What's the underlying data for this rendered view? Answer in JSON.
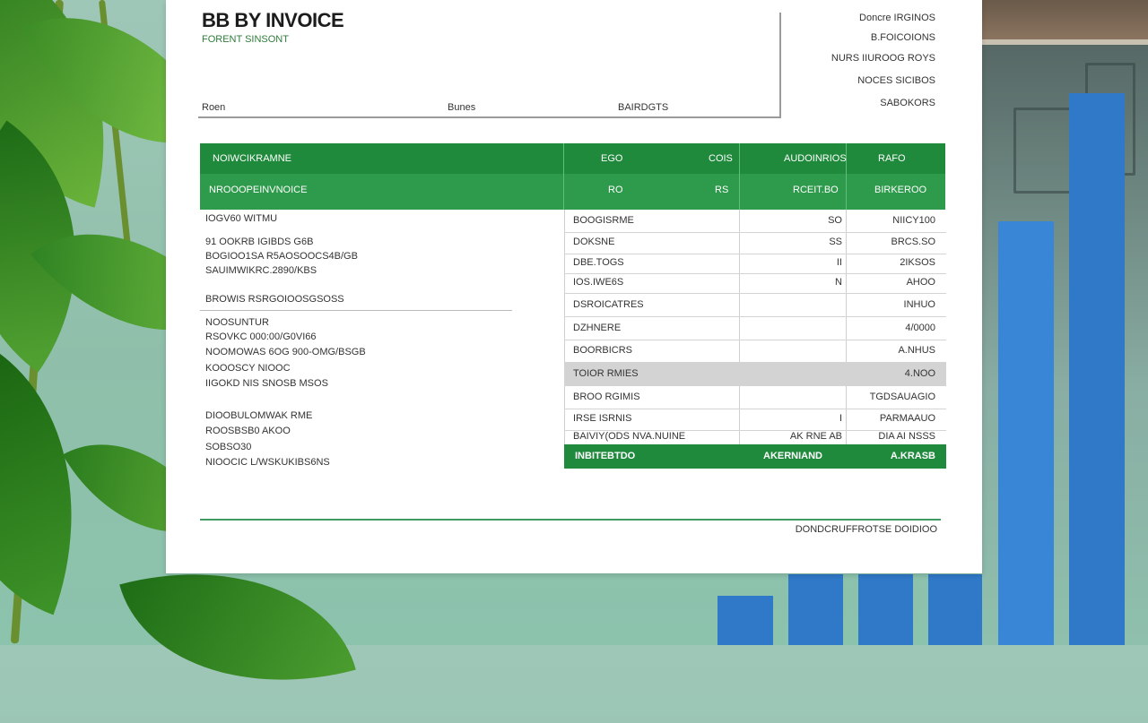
{
  "invoice": {
    "title": "BB BY INVOICE",
    "subtitle": "FORENT SINSONT",
    "header_labels": [
      "Roen",
      "Bunes",
      "BAIRDGTS"
    ],
    "meta": [
      "Doncre IRGINOS",
      "B.FOICOIONS",
      "NURS IIUROOG ROYS",
      "NOCES SICIBOS",
      "SABOKORS"
    ],
    "table_header_row1": [
      "NOIWCIKRAMNE",
      "EGO",
      "COIS",
      "AUDOINRIOS",
      "RAFO"
    ],
    "table_header_row2": [
      "NROOOPEINVNOICE",
      "RO",
      "RS",
      "RCEIT.BO",
      "BIRKEROO"
    ],
    "left_blocks": [
      [
        "IOGV60 WITMU"
      ],
      [
        "91 OOKRB IGIBDS G6B",
        "BOGIOO1SA R5AOSOOCS4B/GB",
        "SAUIMWIKRC.2890/KBS"
      ],
      [
        "BROWIS RSRGOIOOSGSOSS"
      ],
      [
        "NOOSUNTUR",
        "RSOVKC 000:00/G0VI66",
        "NOOMOWAS 6OG 900-OMG/BSGB"
      ],
      [
        "KOOOSCY NIOOC",
        "IIGOKD NIS SNOSB MSOS"
      ],
      [
        "DIOOBULOMWAK RME",
        "ROOSBSB0 AKOO",
        "SOBSO30",
        "NIOOCIC L/WSKUKIBS6NS"
      ]
    ],
    "rows": [
      {
        "c1": "BOOGISRME",
        "c2": "SO",
        "c3": "NIICY100"
      },
      {
        "c1": "DOKSNE",
        "c2": "SS",
        "c3": "BRCS.SO"
      },
      {
        "c1": "DBE.TOGS",
        "c2": "II",
        "c3": "2IKSOS"
      },
      {
        "c1": "IOS.IWE6S",
        "c2": "N",
        "c3": "AHOO"
      },
      {
        "c1": "DSROICATRES",
        "c2": "",
        "c3": "INHUO"
      },
      {
        "c1": "DZHNERE",
        "c2": "",
        "c3": "4/0000"
      },
      {
        "c1": "BOORBICRS",
        "c2": "",
        "c3": "A.NHUS"
      },
      {
        "c1": "TOIOR RMIES",
        "c2": "",
        "c3": "4.NOO"
      },
      {
        "c1": "BROO RGIMIS",
        "c2": "",
        "c3": "TGDSAUAGIO"
      },
      {
        "c1": "IRSE ISRNIS",
        "c2": "I",
        "c3": "PARMAAUO"
      },
      {
        "c1": "BAIVIY(ODS NVA.NUINE",
        "c2": "AK RNE AB",
        "c3": "DIA AI NSSS"
      }
    ],
    "total": {
      "label": "INBITEBTDO",
      "mid": "AKERNIAND",
      "amount": "A.KRASB"
    },
    "footer": "DONDCRUFFROTSE DOIDIOO"
  }
}
